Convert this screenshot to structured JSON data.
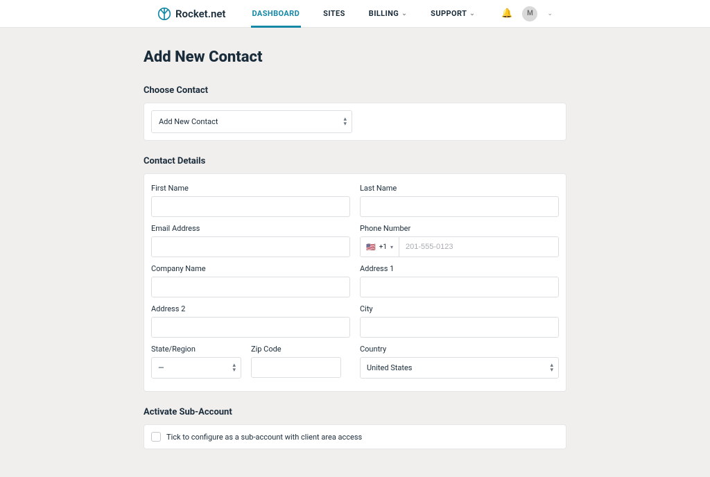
{
  "header": {
    "brand": "Rocket.net",
    "nav": {
      "dashboard": "DASHBOARD",
      "sites": "SITES",
      "billing": "BILLING",
      "support": "SUPPORT"
    },
    "avatar_initial": "M"
  },
  "page": {
    "title": "Add New Contact"
  },
  "choose_contact": {
    "section_title": "Choose Contact",
    "selected": "Add New Contact"
  },
  "contact_details": {
    "section_title": "Contact Details",
    "first_name": {
      "label": "First Name",
      "value": ""
    },
    "last_name": {
      "label": "Last Name",
      "value": ""
    },
    "email": {
      "label": "Email Address",
      "value": ""
    },
    "phone": {
      "label": "Phone Number",
      "prefix": "+1",
      "placeholder": "201-555-0123",
      "value": ""
    },
    "company": {
      "label": "Company Name",
      "value": ""
    },
    "address1": {
      "label": "Address 1",
      "value": ""
    },
    "address2": {
      "label": "Address 2",
      "value": ""
    },
    "city": {
      "label": "City",
      "value": ""
    },
    "state": {
      "label": "State/Region",
      "selected": "—"
    },
    "zip": {
      "label": "Zip Code",
      "value": ""
    },
    "country": {
      "label": "Country",
      "selected": "United States"
    }
  },
  "sub_account": {
    "section_title": "Activate Sub-Account",
    "checkbox_label": "Tick to configure as a sub-account with client area access"
  }
}
